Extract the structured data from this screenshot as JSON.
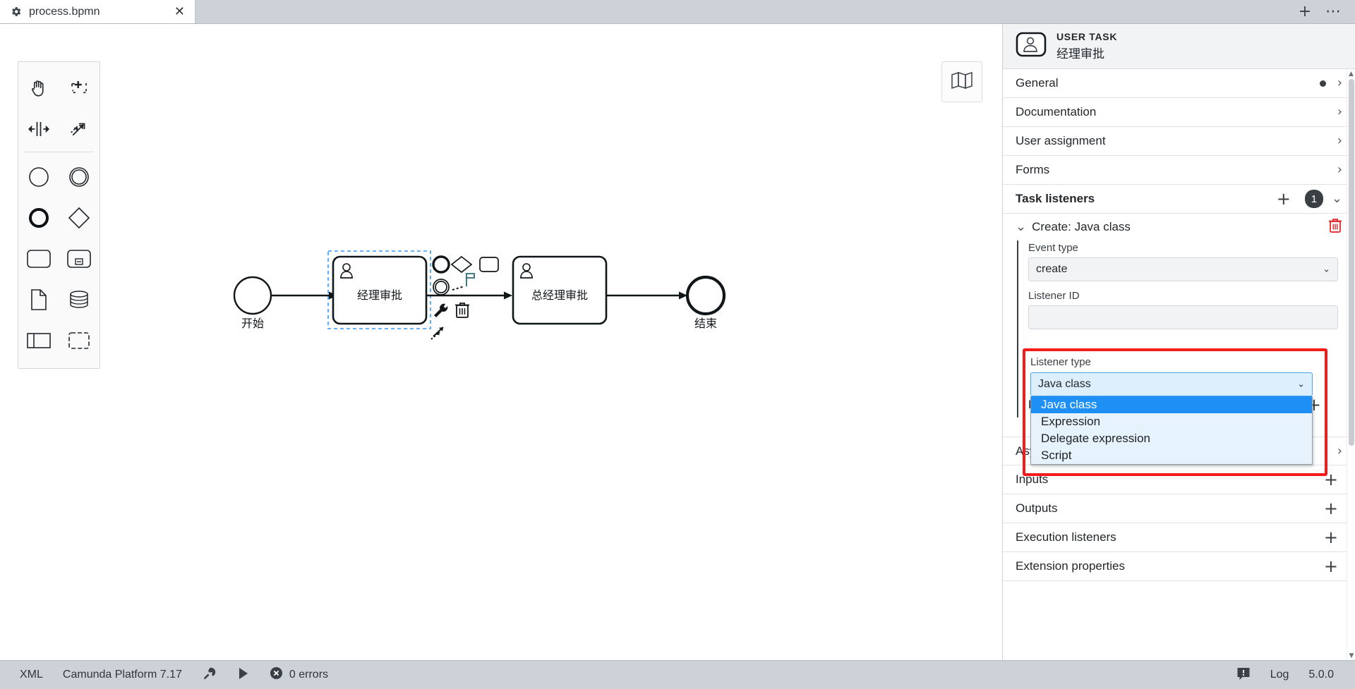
{
  "tabbar": {
    "tab_title": "process.bpmn",
    "tab_icon": "gear-icon",
    "close_label": "✕",
    "new_tab_label": "+",
    "menu_label": "⋯"
  },
  "canvas": {
    "palette": [
      {
        "name": "hand-tool",
        "title": "Activate the hand tool"
      },
      {
        "name": "lasso-tool",
        "title": "Activate the lasso tool"
      },
      {
        "name": "space-tool",
        "title": "Activate the create/remove space tool"
      },
      {
        "name": "connect-tool",
        "title": "Activate the global connect tool"
      },
      {
        "name": "start-event",
        "title": "Create StartEvent"
      },
      {
        "name": "intermediate-event",
        "title": "Create Intermediate/Boundary Event"
      },
      {
        "name": "end-event",
        "title": "Create EndEvent"
      },
      {
        "name": "gateway",
        "title": "Create Gateway"
      },
      {
        "name": "task",
        "title": "Create Task"
      },
      {
        "name": "subprocess",
        "title": "Create expanded SubProcess"
      },
      {
        "name": "data-object",
        "title": "Create DataObjectReference"
      },
      {
        "name": "data-store",
        "title": "Create DataStoreReference"
      },
      {
        "name": "participant",
        "title": "Create Pool/Participant"
      },
      {
        "name": "group",
        "title": "Create Group"
      }
    ],
    "minimap_icon": "map-icon",
    "diagram": {
      "start_event_label": "开始",
      "task1_label": "经理审批",
      "task2_label": "总经理审批",
      "end_event_label": "结束",
      "selection_color": "#3399ff",
      "context_pad": [
        {
          "name": "append-end-event",
          "icon": "end-event-icon"
        },
        {
          "name": "append-gateway",
          "icon": "gateway-icon"
        },
        {
          "name": "append-task",
          "icon": "task-icon"
        },
        {
          "name": "append-intermediate-event",
          "icon": "intermediate-event-icon"
        },
        {
          "name": "connect",
          "icon": "connect-icon"
        },
        {
          "name": "append-text-annotation",
          "icon": "text-annotation-icon"
        },
        {
          "name": "change-type",
          "icon": "wrench-icon"
        },
        {
          "name": "delete",
          "icon": "trash-icon"
        },
        {
          "name": "connect-tool",
          "icon": "connect-arrow-icon"
        }
      ]
    }
  },
  "properties": {
    "header": {
      "type": "USER TASK",
      "name": "经理审批",
      "icon": "user-task-icon"
    },
    "groups": [
      {
        "label": "General",
        "has_dot": true,
        "chevron": "›"
      },
      {
        "label": "Documentation",
        "has_dot": false,
        "chevron": "›"
      },
      {
        "label": "User assignment",
        "has_dot": false,
        "chevron": "›"
      },
      {
        "label": "Forms",
        "has_dot": false,
        "chevron": "›"
      }
    ],
    "task_listeners": {
      "label": "Task listeners",
      "add_label": "+",
      "count": "1",
      "collapse_chevron": "⌄",
      "entry": {
        "title": "Create: Java class",
        "expand_chevron": "⌄",
        "delete_icon": "trash-icon",
        "event_type": {
          "label": "Event type",
          "value": "create",
          "arrow": "⌄"
        },
        "listener_id": {
          "label": "Listener ID",
          "value": ""
        },
        "listener_type": {
          "label": "Listener type",
          "value": "Java class",
          "arrow": "⌄",
          "options": [
            "Java class",
            "Expression",
            "Delegate expression",
            "Script"
          ],
          "selected_index": 0
        },
        "field_injection": {
          "label": "Field injection",
          "add_label": "+"
        }
      }
    },
    "bottom_groups": [
      {
        "label": "Asynchronous continuations",
        "action": "chevron",
        "chevron": "›"
      },
      {
        "label": "Inputs",
        "action": "plus",
        "plus": "+"
      },
      {
        "label": "Outputs",
        "action": "plus",
        "plus": "+"
      },
      {
        "label": "Execution listeners",
        "action": "plus",
        "plus": "+"
      },
      {
        "label": "Extension properties",
        "action": "plus",
        "plus": "+"
      }
    ],
    "scrollbar": {
      "up": "▲",
      "down": "▼"
    }
  },
  "statusbar": {
    "xml_label": "XML",
    "platform_label": "Camunda Platform 7.17",
    "deploy_icon": "rocket-icon",
    "run_icon": "play-icon",
    "errors_icon": "error-icon",
    "errors_label": "0 errors",
    "log_icon": "notification-icon",
    "log_label": "Log",
    "version_label": "5.0.0"
  },
  "colors": {
    "accent": "#1e90f5",
    "highlight": "#f41b1b",
    "chrome": "#cdd2d8",
    "selection": "#3399ff"
  }
}
